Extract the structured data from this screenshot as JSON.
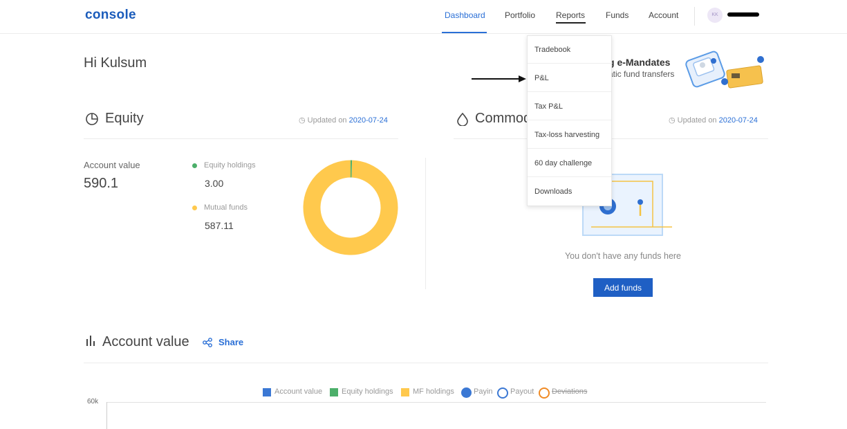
{
  "header": {
    "logo": "console",
    "nav": [
      "Dashboard",
      "Portfolio",
      "Reports",
      "Funds",
      "Account"
    ],
    "active_nav": "Dashboard",
    "avatar_initials": "KK"
  },
  "greeting": "Hi Kulsum",
  "banner": {
    "title": "g e-Mandates",
    "subtitle": "atic fund transfers"
  },
  "equity": {
    "title": "Equity",
    "updated_prefix": "Updated on",
    "updated_date": "2020-07-24",
    "account_value_label": "Account value",
    "account_value": "590.1",
    "holdings_label": "Equity holdings",
    "holdings_value": "3.00",
    "mf_label": "Mutual funds",
    "mf_value": "587.11",
    "donut": {
      "equity_holdings": 3.0,
      "mutual_funds": 587.11
    },
    "colors": {
      "equity": "#4caf6a",
      "mf": "#ffc94d"
    }
  },
  "commodity": {
    "title": "Commod",
    "updated_prefix": "Updated on",
    "updated_date": "2020-07-24",
    "empty_text": "You don't have any funds here",
    "add_funds_label": "Add funds"
  },
  "reports_menu": {
    "items": [
      "Tradebook",
      "P&L",
      "Tax P&L",
      "Tax-loss harvesting",
      "60 day challenge",
      "Downloads"
    ]
  },
  "account_value_chart": {
    "title": "Account value",
    "share_label": "Share",
    "legend": [
      {
        "label": "Account value",
        "color": "#3b78d4",
        "shape": "square"
      },
      {
        "label": "Equity holdings",
        "color": "#4caf6a",
        "shape": "square"
      },
      {
        "label": "MF holdings",
        "color": "#ffc94d",
        "shape": "square"
      },
      {
        "label": "Payin",
        "color": "#3b78d4",
        "shape": "filled-circle"
      },
      {
        "label": "Payout",
        "color": "#3b78d4",
        "shape": "hollow-circle"
      },
      {
        "label": "Deviations",
        "color": "#f08a24",
        "shape": "hollow-circle",
        "disabled": true
      }
    ],
    "y_tick": "60k"
  }
}
